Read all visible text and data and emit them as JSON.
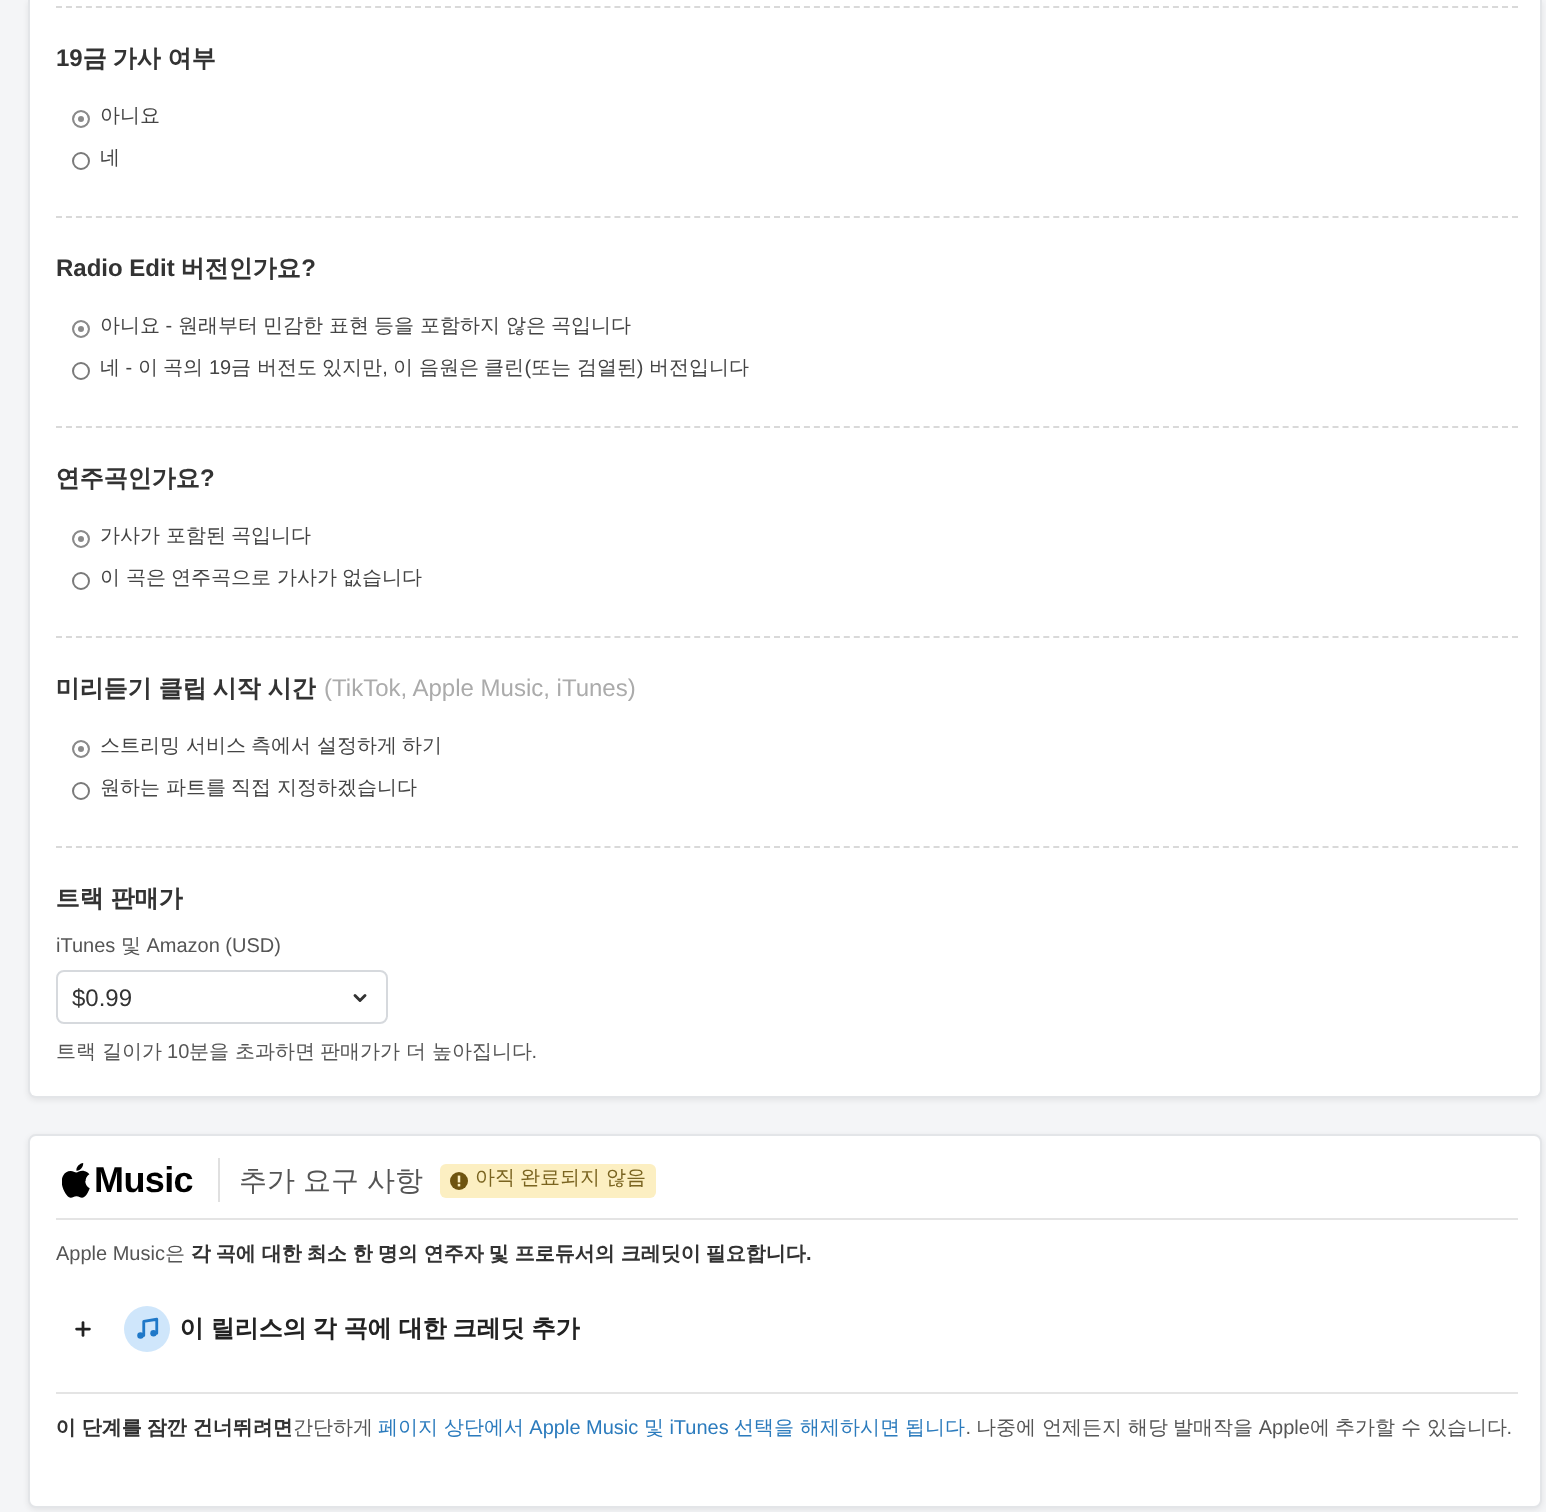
{
  "sections": [
    {
      "kind": "radio",
      "title": "19금 가사 여부",
      "options": [
        {
          "label": "아니요",
          "selected": true
        },
        {
          "label": "네",
          "selected": false
        }
      ]
    },
    {
      "kind": "radio",
      "title": "Radio Edit 버전인가요?",
      "options": [
        {
          "label": "아니요 - 원래부터 민감한 표현 등을 포함하지 않은 곡입니다",
          "selected": true
        },
        {
          "label": "네 - 이 곡의 19금 버전도 있지만, 이 음원은 클린(또는 검열된) 버전입니다",
          "selected": false
        }
      ]
    },
    {
      "kind": "radio",
      "title": "연주곡인가요?",
      "options": [
        {
          "label": "가사가 포함된 곡입니다",
          "selected": true
        },
        {
          "label": "이 곡은 연주곡으로 가사가 없습니다",
          "selected": false
        }
      ]
    },
    {
      "kind": "radio",
      "title": "미리듣기 클립 시작 시간",
      "note": "(TikTok, Apple Music, iTunes)",
      "options": [
        {
          "label": "스트리밍 서비스 측에서 설정하게 하기",
          "selected": true
        },
        {
          "label": "원하는 파트를 직접 지정하겠습니다",
          "selected": false
        }
      ]
    },
    {
      "kind": "price",
      "title": "트랙 판매가",
      "field_label": "iTunes 및 Amazon (USD)",
      "value": "$0.99",
      "hint": "트랙 길이가 10분을 초과하면 판매가가 더 높아집니다."
    }
  ],
  "apple_music": {
    "logo_text": "Music",
    "title": "추가 요구 사항",
    "badge": "아직 완료되지 않음",
    "requirement": "Apple Music은 **각 곡에 대한 최소 한 명의 연주자 및 프로듀서의 크레딧이 필요합니다.**",
    "add_credit": "이 릴리스의 각 곡에 대한 크레딧 추가",
    "skip_note": {
      "before": "**이 단계를 잠깐 건너뛰려면**간단하게 ",
      "link": "페이지 상단에서 Apple Music 및 iTunes 선택을 해제하시면 됩니다",
      "after": ". 나중에 언제든지 해당 발매작을 Apple에 추가할 수 있습니다."
    }
  }
}
